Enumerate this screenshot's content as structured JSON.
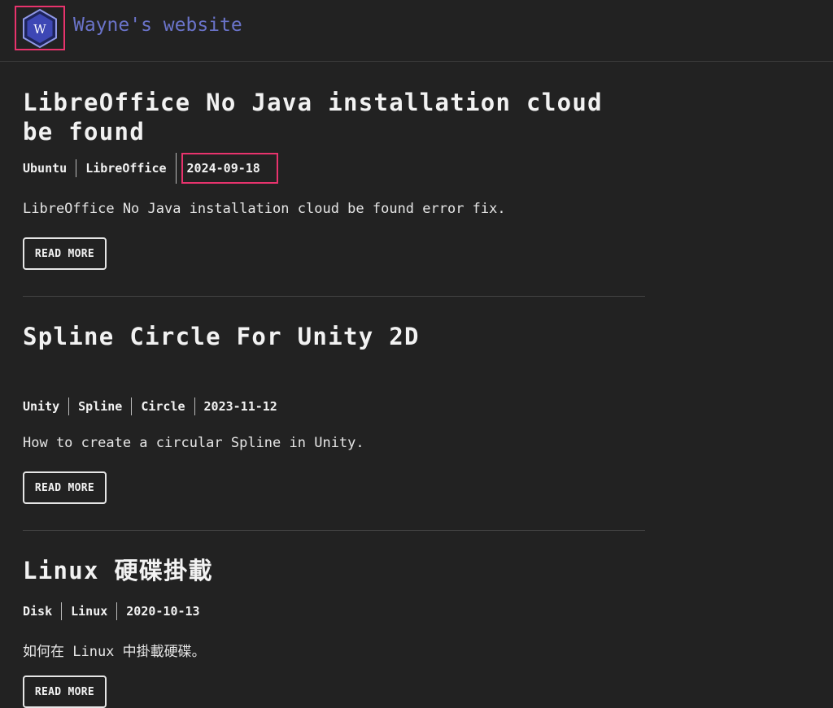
{
  "header": {
    "logo_letter": "W",
    "site_title": "Wayne's website"
  },
  "posts": [
    {
      "title": "LibreOffice No Java installation cloud be found",
      "tags": [
        "Ubuntu",
        "LibreOffice"
      ],
      "date": "2024-09-18",
      "summary": "LibreOffice No Java installation cloud be found error fix.",
      "read_more": "READ MORE"
    },
    {
      "title": "Spline Circle For Unity 2D",
      "tags": [
        "Unity",
        "Spline",
        "Circle"
      ],
      "date": "2023-11-12",
      "summary": "How to create a circular Spline in Unity.",
      "read_more": "READ MORE"
    },
    {
      "title": "Linux 硬碟掛載",
      "tags": [
        "Disk",
        "Linux"
      ],
      "date": "2020-10-13",
      "summary": "如何在 Linux 中掛載硬碟。",
      "read_more": "READ MORE"
    }
  ],
  "colors": {
    "background": "#222222",
    "accent": "#6a73c9",
    "highlight_border": "#e8336d",
    "logo_fill": "#3d47b5"
  },
  "icons": {
    "logo": "hexagon-w-logo-icon"
  }
}
